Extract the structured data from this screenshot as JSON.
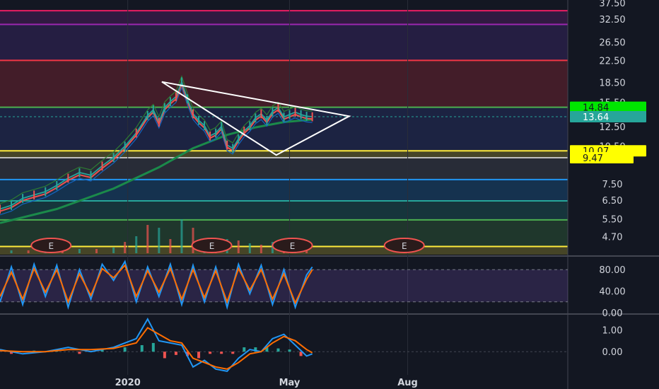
{
  "colors": {
    "background": "#131722",
    "grid": "#2a2e39",
    "price_up": "#26a69a",
    "price_down": "#ef5350",
    "triangle": "#ffffff",
    "stoch_k": "#2196f3",
    "stoch_d": "#ff6d00",
    "macd": "#2196f3",
    "signal": "#ff6d00"
  },
  "chart_data": [
    {
      "type": "line",
      "panel": "price",
      "y_axis_ticks": [
        "37.50",
        "32.50",
        "26.50",
        "22.50",
        "18.50",
        "15.50",
        "12.50",
        "10.50",
        "7.50",
        "6.50",
        "5.50",
        "4.70"
      ],
      "x_axis_ticks": [
        "2020",
        "May",
        "Aug"
      ],
      "scale": "log",
      "ylim": [
        4.0,
        38.5
      ],
      "horizontal_levels": [
        {
          "value": 35.0,
          "color": "#e91e63"
        },
        {
          "value": 31.0,
          "color": "#9c27b0"
        },
        {
          "value": 22.5,
          "color": "#f23645"
        },
        {
          "value": 14.84,
          "color": "#4caf50"
        },
        {
          "value": 10.07,
          "color": "#ffeb3b"
        },
        {
          "value": 9.47,
          "color": "#bdbdbd"
        },
        {
          "value": 7.8,
          "color": "#2196f3"
        },
        {
          "value": 6.45,
          "color": "#26a69a"
        },
        {
          "value": 5.45,
          "color": "#4caf50"
        },
        {
          "value": 4.3,
          "color": "#ffeb3b"
        }
      ],
      "bands": [
        {
          "from": 31.0,
          "to": 35.0,
          "color": "#9c27b0"
        },
        {
          "from": 22.5,
          "to": 31.0,
          "color": "#673ab7"
        },
        {
          "from": 14.84,
          "to": 22.5,
          "color": "#f23645"
        },
        {
          "from": 10.07,
          "to": 14.84,
          "color": "#3f51b5"
        },
        {
          "from": 9.47,
          "to": 10.07,
          "color": "#ffeb3b"
        },
        {
          "from": 7.8,
          "to": 9.47,
          "color": "#787b86"
        },
        {
          "from": 6.45,
          "to": 7.8,
          "color": "#2196f3"
        },
        {
          "from": 5.45,
          "to": 6.45,
          "color": "#26a69a"
        },
        {
          "from": 4.3,
          "to": 5.45,
          "color": "#4caf50"
        },
        {
          "from": 4.0,
          "to": 4.3,
          "color": "#ffeb3b"
        }
      ],
      "price_tags": [
        {
          "label": "14.84",
          "value": 14.84,
          "bg": "#00e600",
          "fg": "#131722"
        },
        {
          "label": "13.64",
          "value": 13.64,
          "bg": "#26a69a",
          "fg": "#ffffff"
        },
        {
          "label": "10.07",
          "value": 10.07,
          "bg": "#ffff00",
          "fg": "#131722"
        },
        {
          "label": "9.47",
          "value": 9.47,
          "bg": "#ffff00",
          "fg": "#131722"
        }
      ],
      "earnings_markers": [
        {
          "label": "E",
          "x_frac": 0.09
        },
        {
          "label": "E",
          "x_frac": 0.373
        },
        {
          "label": "E",
          "x_frac": 0.515
        },
        {
          "label": "E",
          "x_frac": 0.712
        }
      ],
      "triangle": {
        "points": [
          [
            0.05,
            18.6
          ],
          [
            0.615,
            13.7
          ],
          [
            0.395,
            9.7
          ]
        ]
      },
      "series": [
        {
          "role": "close",
          "x": [
            0,
            0.02,
            0.04,
            0.06,
            0.08,
            0.1,
            0.12,
            0.14,
            0.16,
            0.18,
            0.2,
            0.22,
            0.24,
            0.26,
            0.27,
            0.28,
            0.29,
            0.3,
            0.31,
            0.32,
            0.33,
            0.34,
            0.35,
            0.36,
            0.37,
            0.38,
            0.39,
            0.4,
            0.41,
            0.42,
            0.43,
            0.44,
            0.45,
            0.46,
            0.47,
            0.48,
            0.49,
            0.5,
            0.51,
            0.52,
            0.53,
            0.54,
            0.55
          ],
          "values": [
            6.0,
            6.2,
            6.6,
            6.8,
            7.0,
            7.4,
            7.9,
            8.3,
            8.1,
            8.8,
            9.5,
            10.5,
            11.8,
            13.8,
            14.5,
            13.0,
            14.8,
            15.6,
            16.3,
            18.6,
            16.0,
            14.0,
            13.2,
            12.6,
            11.5,
            11.8,
            12.5,
            10.6,
            10.3,
            11.2,
            12.0,
            12.6,
            13.5,
            14.0,
            13.2,
            14.3,
            14.8,
            13.6,
            13.9,
            14.2,
            13.9,
            13.7,
            13.64
          ]
        },
        {
          "role": "long-term moving average",
          "x": [
            0,
            0.1,
            0.2,
            0.28,
            0.34,
            0.4,
            0.45,
            0.5,
            0.55
          ],
          "values": [
            5.3,
            6.0,
            7.2,
            8.7,
            10.3,
            11.6,
            12.4,
            13.0,
            13.3
          ]
        }
      ],
      "volume": {
        "x": [
          0.02,
          0.05,
          0.08,
          0.11,
          0.14,
          0.17,
          0.2,
          0.22,
          0.24,
          0.26,
          0.28,
          0.3,
          0.32,
          0.34,
          0.36,
          0.38,
          0.4,
          0.42,
          0.44,
          0.46,
          0.48,
          0.5,
          0.52,
          0.54
        ],
        "values": [
          2,
          2,
          3,
          2,
          3,
          3,
          4,
          8,
          12,
          20,
          18,
          10,
          24,
          18,
          9,
          8,
          10,
          9,
          7,
          6,
          8,
          7,
          6,
          5
        ]
      }
    },
    {
      "type": "line",
      "panel": "stochastic",
      "y_axis_ticks": [
        "80.00",
        "40.00",
        "0.00"
      ],
      "ylim": [
        0,
        100
      ],
      "band": [
        20,
        80
      ],
      "series": [
        {
          "role": "%K",
          "x": [
            0,
            0.02,
            0.04,
            0.06,
            0.08,
            0.1,
            0.12,
            0.14,
            0.16,
            0.18,
            0.2,
            0.22,
            0.24,
            0.26,
            0.28,
            0.3,
            0.32,
            0.34,
            0.36,
            0.38,
            0.4,
            0.42,
            0.44,
            0.46,
            0.48,
            0.5,
            0.52,
            0.54,
            0.55
          ],
          "values": [
            20,
            85,
            15,
            90,
            30,
            88,
            10,
            80,
            25,
            90,
            60,
            95,
            20,
            85,
            30,
            90,
            15,
            88,
            20,
            85,
            10,
            90,
            35,
            88,
            15,
            80,
            10,
            70,
            85
          ]
        },
        {
          "role": "%D",
          "x": [
            0,
            0.02,
            0.04,
            0.06,
            0.08,
            0.1,
            0.12,
            0.14,
            0.16,
            0.18,
            0.2,
            0.22,
            0.24,
            0.26,
            0.28,
            0.3,
            0.32,
            0.34,
            0.36,
            0.38,
            0.4,
            0.42,
            0.44,
            0.46,
            0.48,
            0.5,
            0.52,
            0.54,
            0.55
          ],
          "values": [
            30,
            75,
            25,
            82,
            38,
            80,
            20,
            72,
            32,
            82,
            65,
            88,
            30,
            78,
            38,
            82,
            25,
            80,
            28,
            78,
            20,
            82,
            42,
            80,
            25,
            72,
            18,
            62,
            80
          ]
        }
      ]
    },
    {
      "type": "line",
      "panel": "macd",
      "y_axis_ticks": [
        "1.00",
        "0.00"
      ],
      "ylim": [
        -1.0,
        1.6
      ],
      "series": [
        {
          "role": "macd",
          "x": [
            0,
            0.04,
            0.08,
            0.12,
            0.16,
            0.2,
            0.24,
            0.26,
            0.28,
            0.3,
            0.32,
            0.34,
            0.36,
            0.38,
            0.4,
            0.42,
            0.44,
            0.46,
            0.48,
            0.5,
            0.52,
            0.54,
            0.55
          ],
          "values": [
            0.1,
            -0.1,
            0.0,
            0.2,
            0.0,
            0.2,
            0.6,
            1.5,
            0.5,
            0.4,
            0.3,
            -0.7,
            -0.4,
            -0.8,
            -0.9,
            -0.3,
            0.1,
            0.0,
            0.6,
            0.8,
            0.3,
            -0.2,
            -0.1
          ]
        },
        {
          "role": "signal",
          "x": [
            0,
            0.04,
            0.08,
            0.12,
            0.16,
            0.2,
            0.24,
            0.26,
            0.28,
            0.3,
            0.32,
            0.34,
            0.36,
            0.38,
            0.4,
            0.42,
            0.44,
            0.46,
            0.48,
            0.5,
            0.52,
            0.54,
            0.55
          ],
          "values": [
            0.05,
            0.0,
            0.0,
            0.1,
            0.1,
            0.15,
            0.4,
            1.1,
            0.8,
            0.5,
            0.4,
            -0.3,
            -0.5,
            -0.7,
            -0.8,
            -0.5,
            -0.1,
            0.0,
            0.4,
            0.7,
            0.5,
            0.1,
            -0.05
          ]
        }
      ],
      "histogram": {
        "x": [
          0.02,
          0.06,
          0.1,
          0.14,
          0.18,
          0.22,
          0.25,
          0.27,
          0.29,
          0.31,
          0.33,
          0.35,
          0.37,
          0.39,
          0.41,
          0.43,
          0.45,
          0.47,
          0.49,
          0.51,
          0.53
        ],
        "values": [
          -0.1,
          0.05,
          0.05,
          -0.1,
          0.1,
          0.2,
          0.3,
          0.4,
          -0.3,
          -0.15,
          -0.2,
          -0.3,
          -0.1,
          -0.1,
          -0.1,
          0.2,
          0.2,
          0.2,
          0.15,
          0.1,
          -0.2
        ]
      }
    }
  ]
}
